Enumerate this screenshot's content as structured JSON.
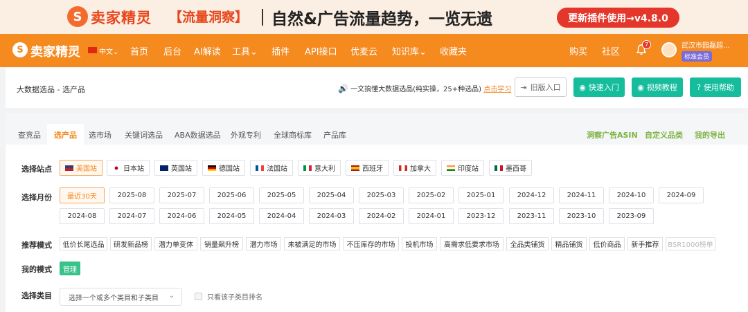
{
  "banner": {
    "logo_glyph": "S",
    "brand": "卖家精灵",
    "tag": "【流量洞察】",
    "slogan": "自然&广告流量趋势，一览无遗",
    "cta": "更新插件使用→v4.8.0"
  },
  "nav": {
    "logo_glyph": "S",
    "brand": "卖家精灵",
    "lang": "中文⌄",
    "items": [
      "首页",
      "后台",
      "AI解读",
      "工具⌄",
      "插件",
      "API接口",
      "优麦云",
      "知识库⌄",
      "收藏夹"
    ],
    "right_items": [
      "购买",
      "社区"
    ],
    "notif_count": "7",
    "user_name": "武汉市园磊超...",
    "user_level": "标准会员"
  },
  "header": {
    "breadcrumb": "大数据选品 - 选产品",
    "notice_text": "一文搞懂大数据选品(纯实操，25+种选品)",
    "notice_link": "点击学习",
    "old_version": "旧版入口",
    "quick_start": "快速入门",
    "video_tutorial": "视频教程",
    "help": "使用帮助"
  },
  "tabs": {
    "items": [
      "查竞品",
      "选产品",
      "选市场",
      "关键词选品",
      "ABA数据选品",
      "外观专利",
      "全球商标库",
      "产品库"
    ],
    "active": "选产品",
    "right": [
      "洞察广告ASIN",
      "自定义品类",
      "我的导出"
    ]
  },
  "filters": {
    "site_label": "选择站点",
    "sites": [
      "美国站",
      "日本站",
      "英国站",
      "德国站",
      "法国站",
      "意大利",
      "西班牙",
      "加拿大",
      "印度站",
      "墨西哥"
    ],
    "month_label": "选择月份",
    "months_row1": [
      "最近30天",
      "2025-08",
      "2025-07",
      "2025-06",
      "2025-05",
      "2025-04",
      "2025-03",
      "2025-02",
      "2025-01",
      "2024-12",
      "2024-11",
      "2024-10",
      "2024-09"
    ],
    "months_row2": [
      "2024-08",
      "2024-07",
      "2024-06",
      "2024-05",
      "2024-04",
      "2024-03",
      "2024-02",
      "2024-01",
      "2023-12",
      "2023-11",
      "2023-10",
      "2023-09"
    ],
    "mode_label": "推荐模式",
    "modes": [
      "低价长尾选品",
      "研发新品榜",
      "潜力单变体",
      "销量飙升榜",
      "潜力市场",
      "未被满足的市场",
      "不压库存的市场",
      "投机市场",
      "高需求低要求市场",
      "全品类铺货",
      "精品铺货",
      "低价商品",
      "新手推荐",
      "BSR1000榜单"
    ],
    "my_mode_label": "我的模式",
    "manage": "管理",
    "category_label": "选择类目",
    "category_placeholder": "选择一个或多个类目和子类目",
    "only_sub": "只看该子类目排名"
  },
  "colors": {
    "accent": "#f58a1f",
    "green": "#15bd9c",
    "banner_red": "#e4362a"
  }
}
